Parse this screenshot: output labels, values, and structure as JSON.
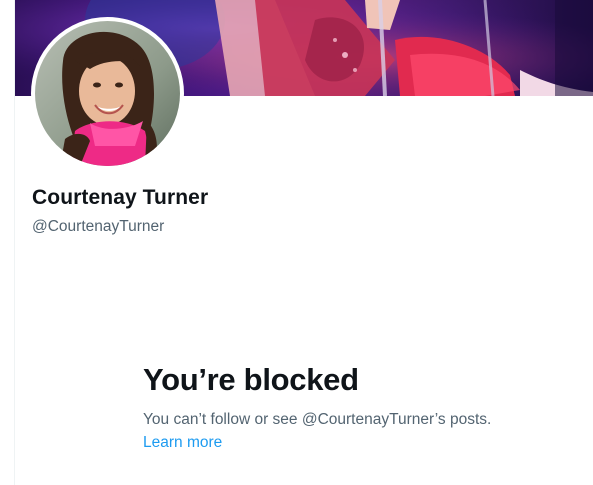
{
  "profile": {
    "display_name": "Courtenay Turner",
    "handle": "@CourtenayTurner",
    "banner_image": "profile-banner-photo",
    "avatar_image": "profile-avatar-photo"
  },
  "blocked": {
    "title": "You’re blocked",
    "message": "You can’t follow or see @CourtenayTurner’s posts.",
    "link_label": "Learn more"
  },
  "colors": {
    "text_primary": "#0f1419",
    "text_secondary": "#536471",
    "link": "#1d9bf0",
    "background": "#ffffff"
  }
}
